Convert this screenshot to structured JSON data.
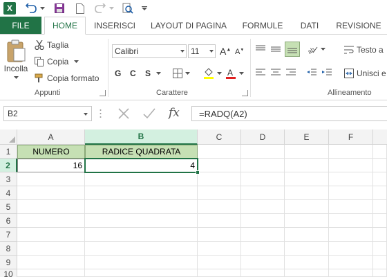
{
  "app": {
    "logo_letter": "X"
  },
  "tabs": {
    "file": "FILE",
    "items": [
      {
        "label": "HOME"
      },
      {
        "label": "INSERISCI"
      },
      {
        "label": "LAYOUT DI PAGINA"
      },
      {
        "label": "FORMULE"
      },
      {
        "label": "DATI"
      },
      {
        "label": "REVISIONE"
      }
    ]
  },
  "ribbon": {
    "clipboard": {
      "paste": "Incolla",
      "cut": "Taglia",
      "copy": "Copia",
      "format_painter": "Copia formato",
      "group": "Appunti"
    },
    "font": {
      "name": "Calibri",
      "size": "11",
      "bold": "G",
      "italic": "C",
      "underline": "S",
      "group": "Carattere"
    },
    "alignment": {
      "wrap": "Testo a",
      "merge": "Unisci e",
      "group": "Allineamento"
    }
  },
  "formula_bar": {
    "name_box": "B2",
    "formula": "=RADQ(A2)"
  },
  "grid": {
    "columns": [
      "A",
      "B",
      "C",
      "D",
      "E",
      "F"
    ],
    "rows": [
      "1",
      "2",
      "3",
      "4",
      "5",
      "6",
      "7",
      "8",
      "9",
      "10"
    ],
    "cells": {
      "A1": "NUMERO",
      "B1": "RADICE QUADRATA",
      "A2": "16",
      "B2": "4"
    }
  },
  "colors": {
    "accent": "#217346",
    "header_fill": "#c6e0b4",
    "selected_header": "#d3f0e0"
  }
}
